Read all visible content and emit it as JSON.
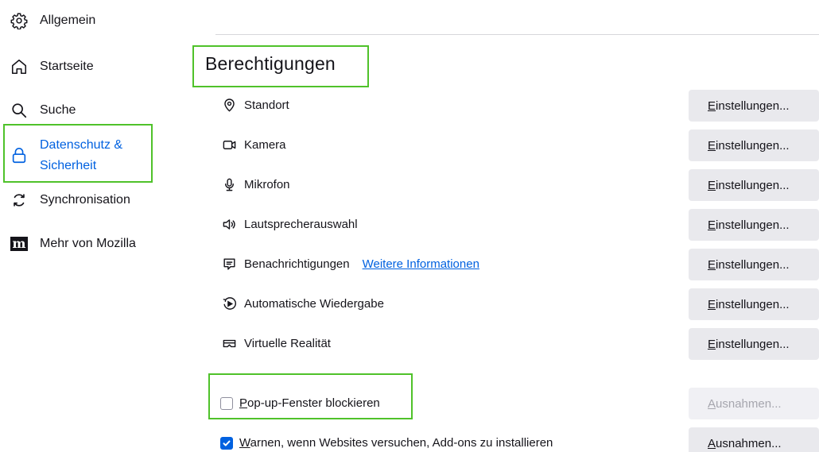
{
  "sidebar": {
    "items": [
      {
        "label": "Allgemein",
        "icon": "gear-icon"
      },
      {
        "label": "Startseite",
        "icon": "home-icon"
      },
      {
        "label": "Suche",
        "icon": "search-icon"
      },
      {
        "label_line1": "Datenschutz &",
        "label_line2": "Sicherheit",
        "icon": "lock-icon",
        "active": true
      },
      {
        "label": "Synchronisation",
        "icon": "sync-icon"
      },
      {
        "label": "Mehr von Mozilla",
        "icon": "mozilla-icon",
        "icon_text": "m"
      }
    ]
  },
  "main": {
    "section_title": "Berechtigungen",
    "permissions": [
      {
        "label": "Standort",
        "icon": "location-icon",
        "button_access_key": "E",
        "button_rest": "instellungen..."
      },
      {
        "label": "Kamera",
        "icon": "camera-icon",
        "button_access_key": "E",
        "button_rest": "instellungen..."
      },
      {
        "label": "Mikrofon",
        "icon": "microphone-icon",
        "button_access_key": "E",
        "button_rest": "instellungen..."
      },
      {
        "label": "Lautsprecherauswahl",
        "icon": "speaker-icon",
        "button_access_key": "E",
        "button_rest": "instellungen..."
      },
      {
        "label": "Benachrichtigungen",
        "icon": "notification-icon",
        "link": "Weitere Informationen",
        "button_access_key": "E",
        "button_rest": "instellungen..."
      },
      {
        "label": "Automatische Wiedergabe",
        "icon": "autoplay-icon",
        "button_access_key": "E",
        "button_rest": "instellungen..."
      },
      {
        "label": "Virtuelle Realität",
        "icon": "vr-icon",
        "button_access_key": "E",
        "button_rest": "instellungen..."
      }
    ],
    "popup_block": {
      "access_key": "P",
      "label_rest": "op-up-Fenster blockieren",
      "checked": false,
      "button_access_key": "A",
      "button_rest": "usnahmen...",
      "button_disabled": true
    },
    "addon_warn": {
      "access_key": "W",
      "label_rest": "arnen, wenn Websites versuchen, Add-ons zu installieren",
      "checked": true,
      "button_access_key": "A",
      "button_rest": "usnahmen..."
    }
  },
  "colors": {
    "accent": "#0061e0",
    "highlight": "#4fc22a",
    "button_bg": "#e9e9ed"
  }
}
